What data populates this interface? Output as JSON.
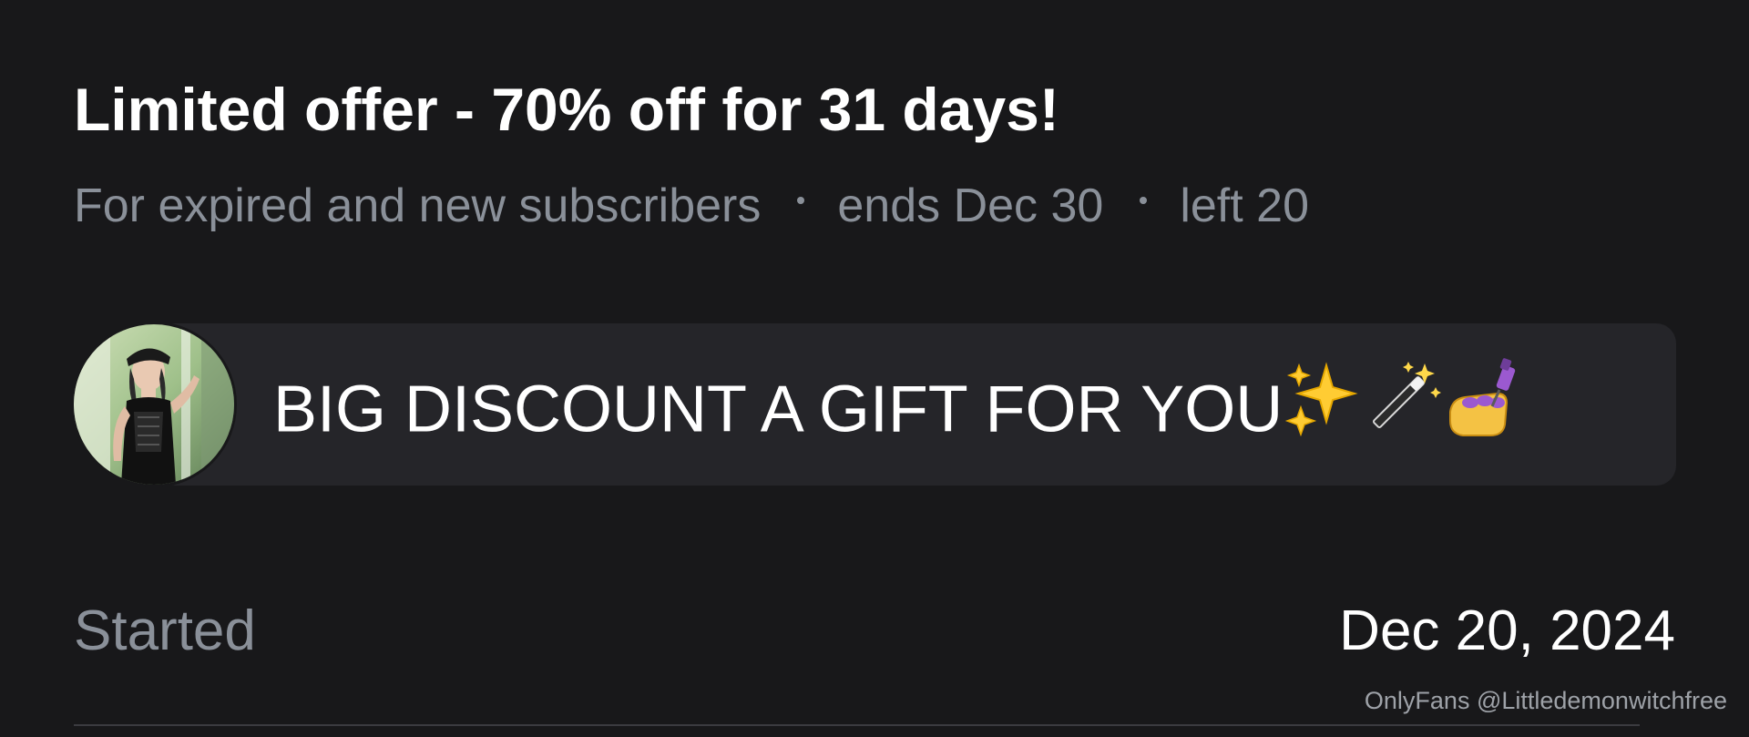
{
  "offer": {
    "title": "Limited offer - 70% off for 31 days!",
    "audience": "For expired and new subscribers",
    "ends": "ends Dec 30",
    "remaining": "left 20"
  },
  "promo": {
    "message": "BIG DISCOUNT A GIFT FOR YOU",
    "emojis": [
      "sparkles-icon",
      "magic-wand-icon",
      "nail-polish-icon"
    ]
  },
  "details": {
    "started_label": "Started",
    "started_value": "Dec 20, 2024"
  },
  "watermark": "OnlyFans @Littledemonwitchfree"
}
